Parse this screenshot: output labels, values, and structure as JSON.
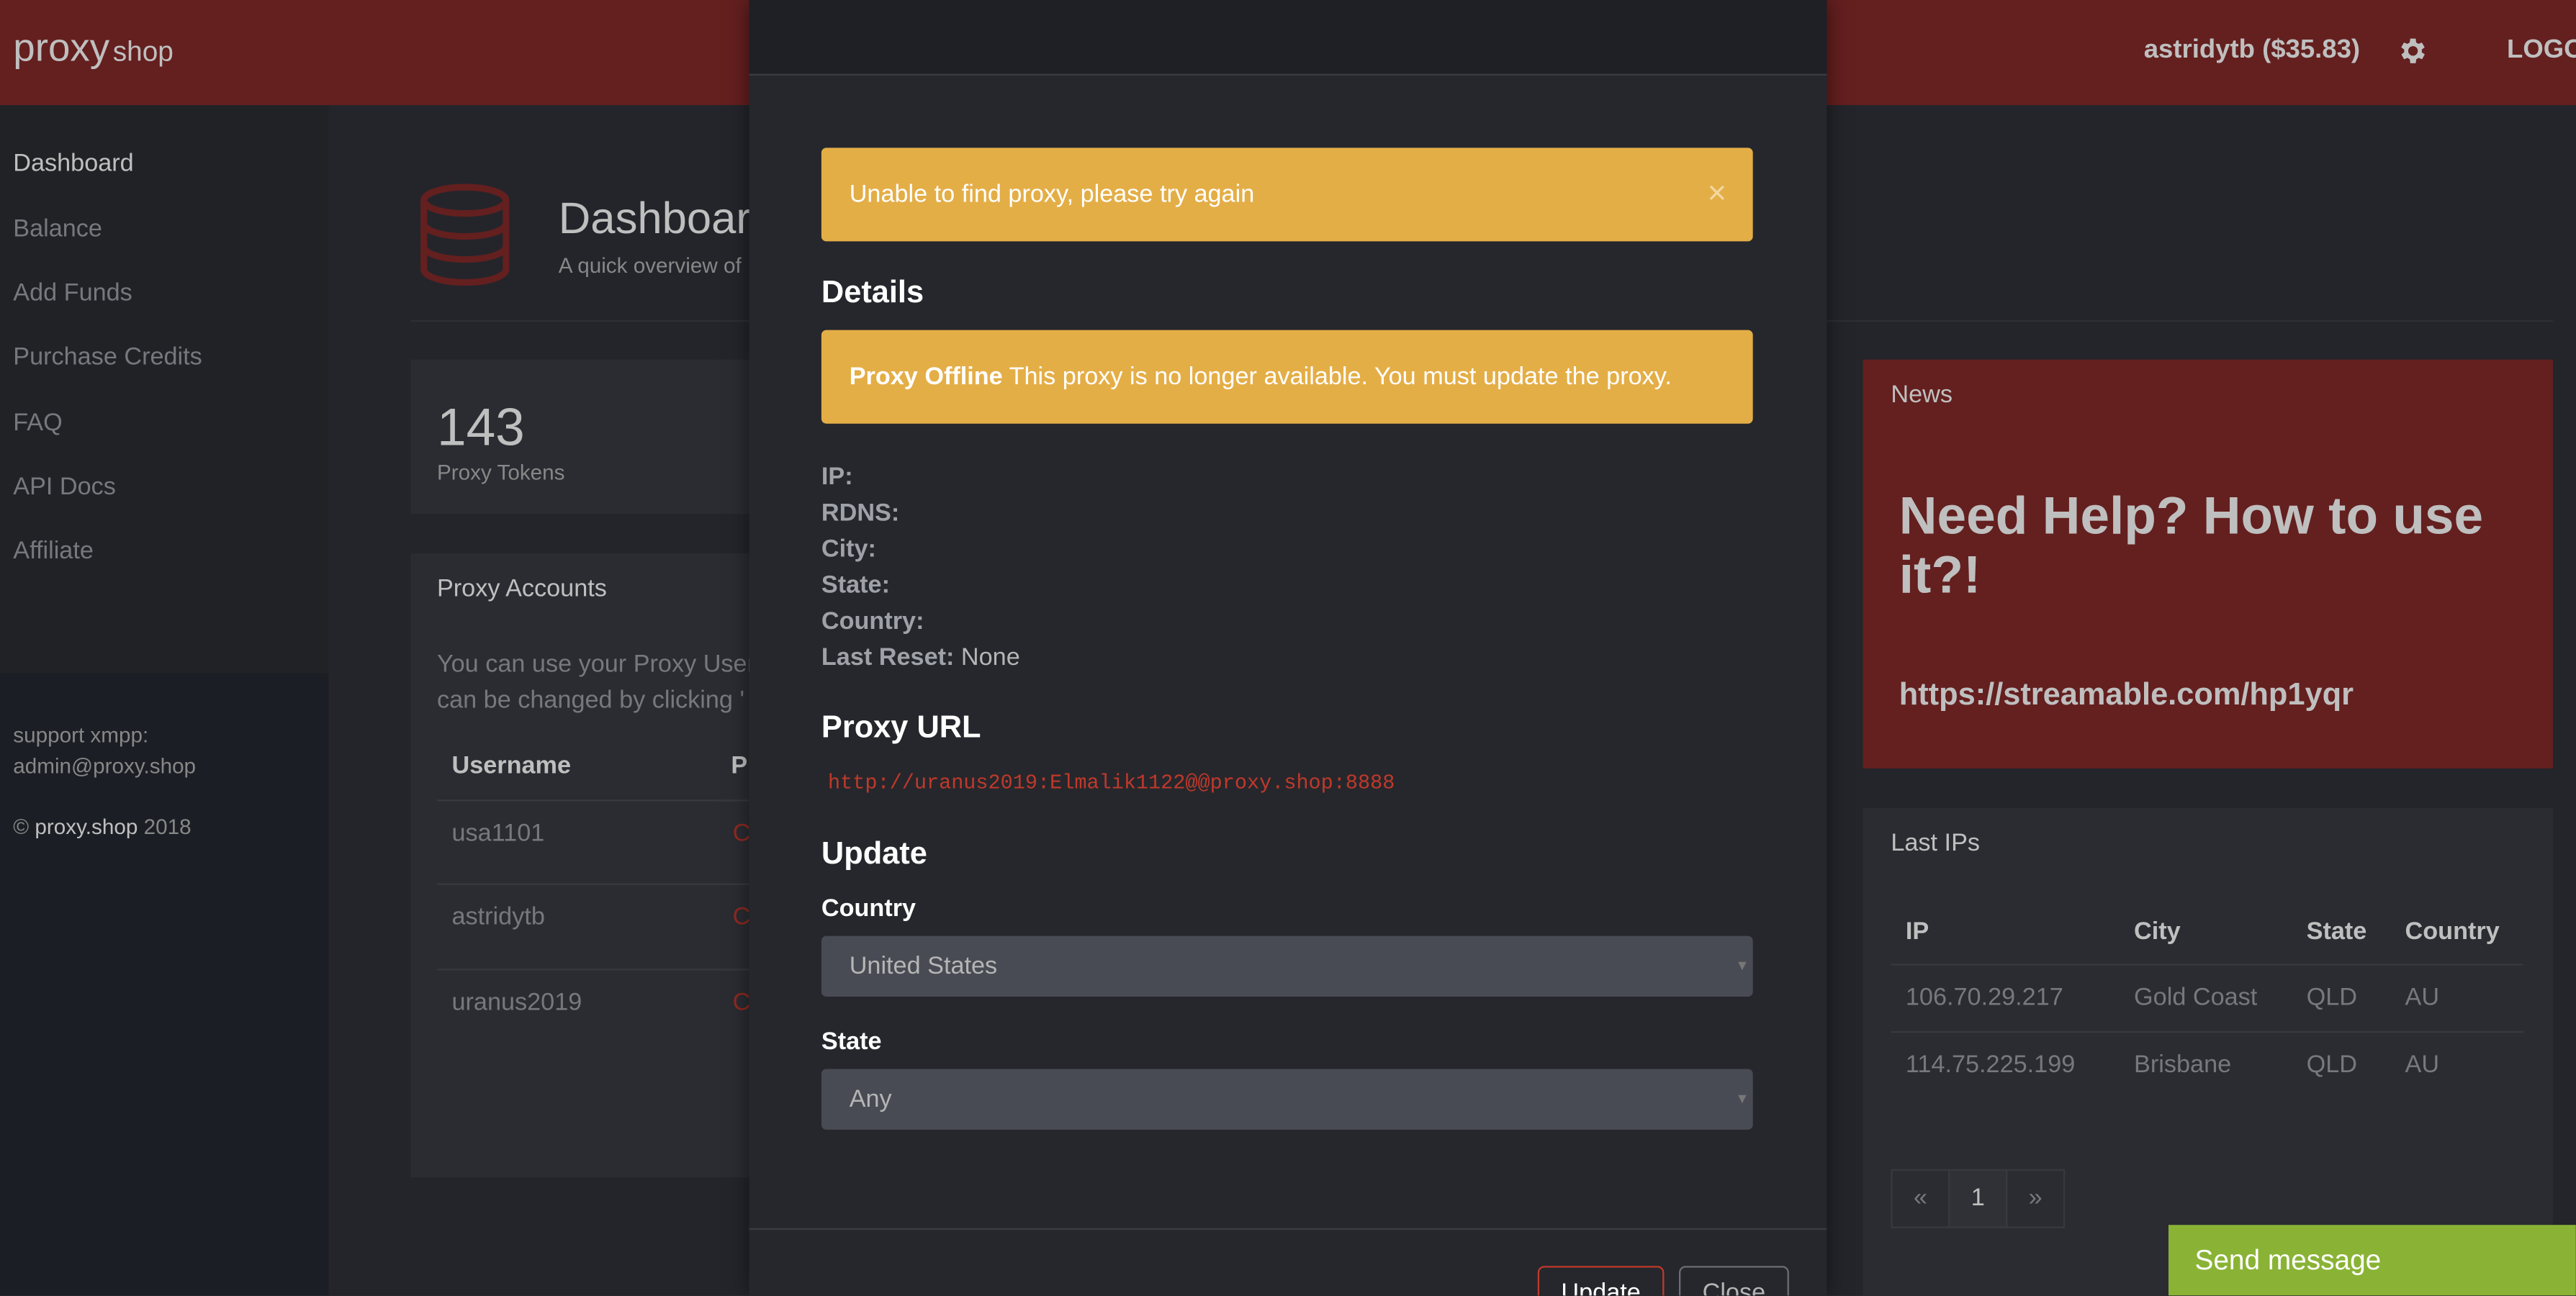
{
  "app": {
    "brand": "proxy",
    "brand_small": "shop",
    "user": "astridytb ($35.83)",
    "logout": "LOGOUT"
  },
  "sidebar": {
    "items": [
      {
        "label": "Dashboard",
        "active": true
      },
      {
        "label": "Balance"
      },
      {
        "label": "Add Funds"
      },
      {
        "label": "Purchase Credits"
      },
      {
        "label": "FAQ"
      },
      {
        "label": "API Docs"
      },
      {
        "label": "Affiliate"
      }
    ],
    "support_line1": "support xmpp:",
    "support_line2": "admin@proxy.shop",
    "copy_prefix": "©",
    "copy_site": "proxy.shop",
    "copy_year": "2018"
  },
  "dashboard": {
    "title": "Dashboard",
    "subtitle": "A quick overview of",
    "tokens_value": "143",
    "tokens_label": "Proxy Tokens",
    "accounts_title": "Proxy Accounts",
    "accounts_text_1": "You can use your Proxy User",
    "accounts_text_2": "can be changed by clicking '",
    "col_username": "Username",
    "col_p": "P",
    "rows": [
      {
        "username": "usa1101",
        "c": "C"
      },
      {
        "username": "astridytb",
        "c": "C"
      },
      {
        "username": "uranus2019",
        "c": "C"
      }
    ]
  },
  "news": {
    "label": "News",
    "headline": "Need Help? How to use it?!",
    "link": "https://streamable.com/hp1yqr"
  },
  "last_ips": {
    "label": "Last IPs",
    "headers": [
      "IP",
      "City",
      "State",
      "Country"
    ],
    "rows": [
      [
        "106.70.29.217",
        "Gold Coast",
        "QLD",
        "AU"
      ],
      [
        "114.75.225.199",
        "Brisbane",
        "QLD",
        "AU"
      ]
    ],
    "pager": [
      "«",
      "1",
      "»"
    ]
  },
  "chat": {
    "label": "Send message"
  },
  "modal": {
    "error_alert": "Unable to find proxy, please try again",
    "close_x": "×",
    "details_heading": "Details",
    "offline_bold": "Proxy Offline",
    "offline_text": " This proxy is no longer available. You must update the proxy.",
    "fields": {
      "ip": "IP:",
      "rdns": "RDNS:",
      "city": "City:",
      "state": "State:",
      "country": "Country:",
      "last_reset": "Last Reset:",
      "last_reset_value": " None"
    },
    "url_heading": "Proxy URL",
    "url": "http://uranus2019:Elmalik1122@@proxy.shop:8888",
    "update_heading": "Update",
    "country_label": "Country",
    "country_value": "United States",
    "state_label": "State",
    "state_value": "Any",
    "btn_update": "Update",
    "btn_close": "Close"
  },
  "colors": {
    "brand_red": "#862a2a",
    "warning": "#e4ae47",
    "chat_green": "#8ab336"
  },
  "icons": {
    "gear": "gear-icon",
    "database": "database-icon"
  }
}
